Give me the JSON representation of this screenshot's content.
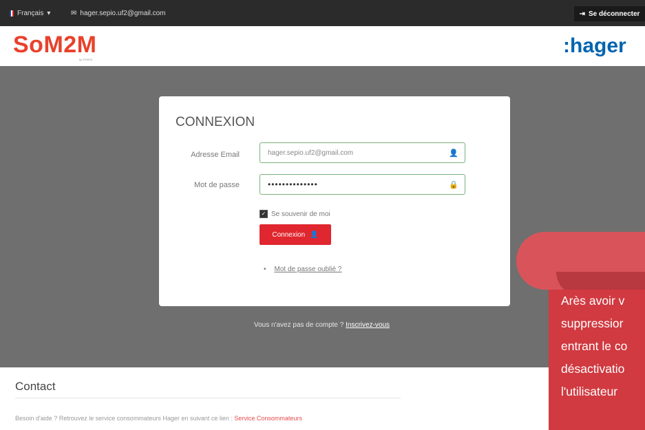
{
  "topbar": {
    "language": "Français",
    "email": "hager.sepio.uf2@gmail.com",
    "logout": "Se déconnecter"
  },
  "header": {
    "brand": "SoM2M",
    "brand_sub": "by SYNOX",
    "partner": ":hager"
  },
  "login": {
    "title": "CONNEXION",
    "email_label": "Adresse Email",
    "email_value": "hager.sepio.uf2@gmail.com",
    "password_label": "Mot de passe",
    "password_value": "••••••••••••••",
    "remember_label": "Se souvenir de moi",
    "remember_checked": true,
    "submit_label": "Connexion",
    "forgot_label": "Mot de passe oublié ?"
  },
  "signup": {
    "text": "Vous n'avez pas de compte ?",
    "link": "Inscrivez-vous"
  },
  "contact": {
    "title": "Contact",
    "text": "Besoin d'aide ? Retrouvez le service consommateurs Hager en suivant ce lien :",
    "link": "Service Consommateurs"
  },
  "callout": {
    "lines": [
      "Arès avoir v",
      "suppressior",
      "entrant le co",
      "désactivatio",
      "l'utilisateur"
    ]
  },
  "colors": {
    "accent": "#e0262f",
    "brand_red": "#e8412c",
    "hager_blue": "#0064b0",
    "callout": "#d03a40"
  }
}
